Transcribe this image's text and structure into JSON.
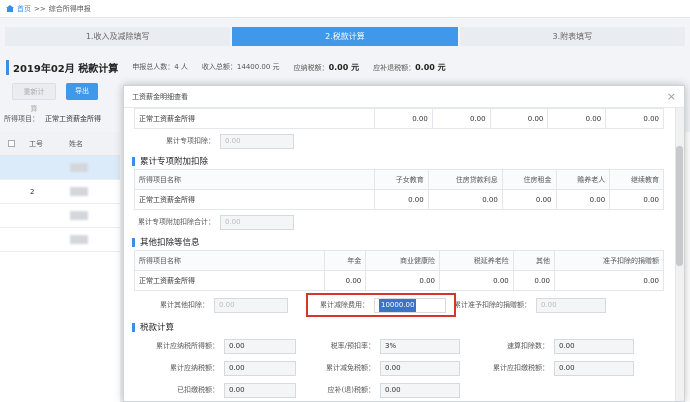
{
  "breadcrumb": {
    "home": "首页",
    "sep": ">>",
    "current": "综合所得申报"
  },
  "steps": [
    {
      "label": "1.收入及减除填写",
      "active": false
    },
    {
      "label": "2.税款计算",
      "active": true
    },
    {
      "label": "3.附表填写",
      "active": false
    }
  ],
  "summary": {
    "period": "2019年02月 税款计算",
    "declare_count_label": "申报总人数：",
    "declare_count": "4 人",
    "income_label": "收入总额：",
    "income": "14400.00 元",
    "tax_due_label": "应纳税额：",
    "tax_due": "0.00 元",
    "refund_label": "应补退税额：",
    "refund": "0.00 元"
  },
  "buttons": {
    "recalc": "重新计算",
    "export": "导出"
  },
  "filter": {
    "label": "所得项目：",
    "value": "正常工资薪金所得"
  },
  "table": {
    "headers": [
      "工号",
      "姓名"
    ],
    "rows": [
      {
        "no": "",
        "selected": true
      },
      {
        "no": "2",
        "selected": false
      },
      {
        "no": "",
        "selected": false
      },
      {
        "no": "",
        "selected": false
      }
    ]
  },
  "modal": {
    "title": "工资薪金明细查看",
    "top_row": {
      "name": "正常工资薪金所得",
      "values": [
        "0.00",
        "0.00",
        "0.00",
        "0.00",
        "0.00"
      ]
    },
    "special_deduction_label": "累计专项扣除：",
    "special_deduction_value": "0.00",
    "section_additional": "累计专项附加扣除",
    "additional_headers": {
      "name": "所得项目名称",
      "cols": [
        "子女教育",
        "住房贷款利息",
        "住房租金",
        "赡养老人",
        "继续教育"
      ]
    },
    "additional_row": {
      "name": "正常工资薪金所得",
      "values": [
        "0.00",
        "0.00",
        "0.00",
        "0.00",
        "0.00"
      ]
    },
    "additional_total_label": "累计专项附加扣除合计：",
    "additional_total_value": "0.00",
    "section_other": "其他扣除等信息",
    "other_headers": {
      "name": "所得项目名称",
      "cols": [
        "年金",
        "商业健康险",
        "税延养老险",
        "其他",
        "准予扣除的捐赠额"
      ]
    },
    "other_row": {
      "name": "正常工资薪金所得",
      "values": [
        "0.00",
        "0.00",
        "0.00",
        "0.00",
        "0.00"
      ]
    },
    "other_total_label": "累计其他扣除：",
    "other_total_value": "0.00",
    "deduct_fee_label": "累计减除费用：",
    "deduct_fee_value": "10000.00",
    "donation_label": "累计准予扣除的捐赠额：",
    "donation_value": "0.00",
    "section_tax": "税款计算",
    "tax_rows": [
      [
        {
          "label": "累计应纳税所得额：",
          "value": "0.00"
        },
        {
          "label": "税率/预扣率：",
          "value": "3%"
        },
        {
          "label": "速算扣除数：",
          "value": "0.00"
        }
      ],
      [
        {
          "label": "累计应纳税额：",
          "value": "0.00"
        },
        {
          "label": "累计减免税额：",
          "value": "0.00"
        },
        {
          "label": "累计应扣缴税额：",
          "value": "0.00"
        }
      ],
      [
        {
          "label": "已扣缴税额：",
          "value": "0.00"
        },
        {
          "label": "应补(退)税额：",
          "value": "0.00"
        }
      ]
    ]
  }
}
